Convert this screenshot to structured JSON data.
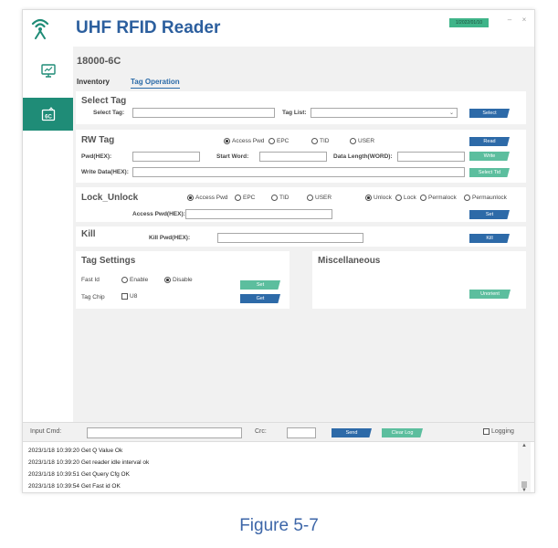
{
  "app": {
    "title": "UHF RFID Reader",
    "date_badge": "1/2022/01/10",
    "minimize_glyph": "–",
    "close_glyph": "×"
  },
  "sidebar": {
    "items": [
      {
        "icon": "monitor-settings-icon",
        "active": false
      },
      {
        "icon": "6c-tag-icon",
        "active": true
      }
    ]
  },
  "main": {
    "section_title": "18000-6C",
    "tabs": [
      {
        "label": "Inventory",
        "active": false
      },
      {
        "label": "Tag Operation",
        "active": true
      }
    ]
  },
  "select_tag": {
    "title": "Select Tag",
    "tag_label": "Select Tag:",
    "tag_value": "",
    "list_label": "Tag List:",
    "list_value": "",
    "button": "Select"
  },
  "rw_tag": {
    "title": "RW Tag",
    "memory_options": [
      "Access Pwd",
      "EPC",
      "TID",
      "USER"
    ],
    "selected": "Access Pwd",
    "read_button": "Read",
    "pwd_label": "Pwd(HEX):",
    "pwd_value": "",
    "start_label": "Start Word:",
    "start_value": "",
    "length_label": "Data Length(WORD):",
    "length_value": "",
    "write_button": "Write",
    "data_label": "Write Data(HEX):",
    "data_value": "",
    "select_tid_button": "Select Tid"
  },
  "lock_unlock": {
    "title": "Lock_Unlock",
    "memory_options": [
      "Access Pwd",
      "EPC",
      "TID",
      "USER"
    ],
    "memory_selected": "Access Pwd",
    "lock_options": [
      "Unlock",
      "Lock",
      "Permalock",
      "Permaunlock"
    ],
    "lock_selected": "Unlock",
    "pwd_label": "Access Pwd(HEX):",
    "pwd_value": "",
    "set_button": "Set"
  },
  "kill": {
    "title": "Kill",
    "pwd_label": "Kill Pwd(HEX):",
    "pwd_value": "",
    "button": "Kill"
  },
  "tag_settings": {
    "title": "Tag Settings",
    "fast_id_label": "Fast Id",
    "fast_id_options": [
      "Enable",
      "Disable"
    ],
    "fast_id_selected": "Disable",
    "set_button": "Set",
    "tag_chip_label": "Tag Chip",
    "u8_label": "U8",
    "u8_checked": false,
    "get_button": "Get"
  },
  "misc": {
    "title": "Miscellaneous",
    "unorient_button": "Unorient"
  },
  "command": {
    "input_label": "Input Cmd:",
    "input_value": "",
    "crc_label": "Crc:",
    "crc_value": "",
    "send_button": "Send",
    "clear_button": "Clear Log",
    "logging_label": "Logging",
    "logging_checked": false
  },
  "log": {
    "lines": [
      "2023/1/18 10:39:20 Get Q Value Ok",
      "2023/1/18 10:39:20 Get reader idle interval ok",
      "2023/1/18 10:39:51 Get Query Cfg OK",
      "2023/1/18 10:39:54 Get Fast id OK"
    ]
  },
  "caption": "Figure 5-7",
  "colors": {
    "accent_blue": "#2d6aa8",
    "accent_green": "#5cbe9e",
    "sidebar_active": "#1f8c77",
    "title_blue": "#2c5f9e"
  }
}
